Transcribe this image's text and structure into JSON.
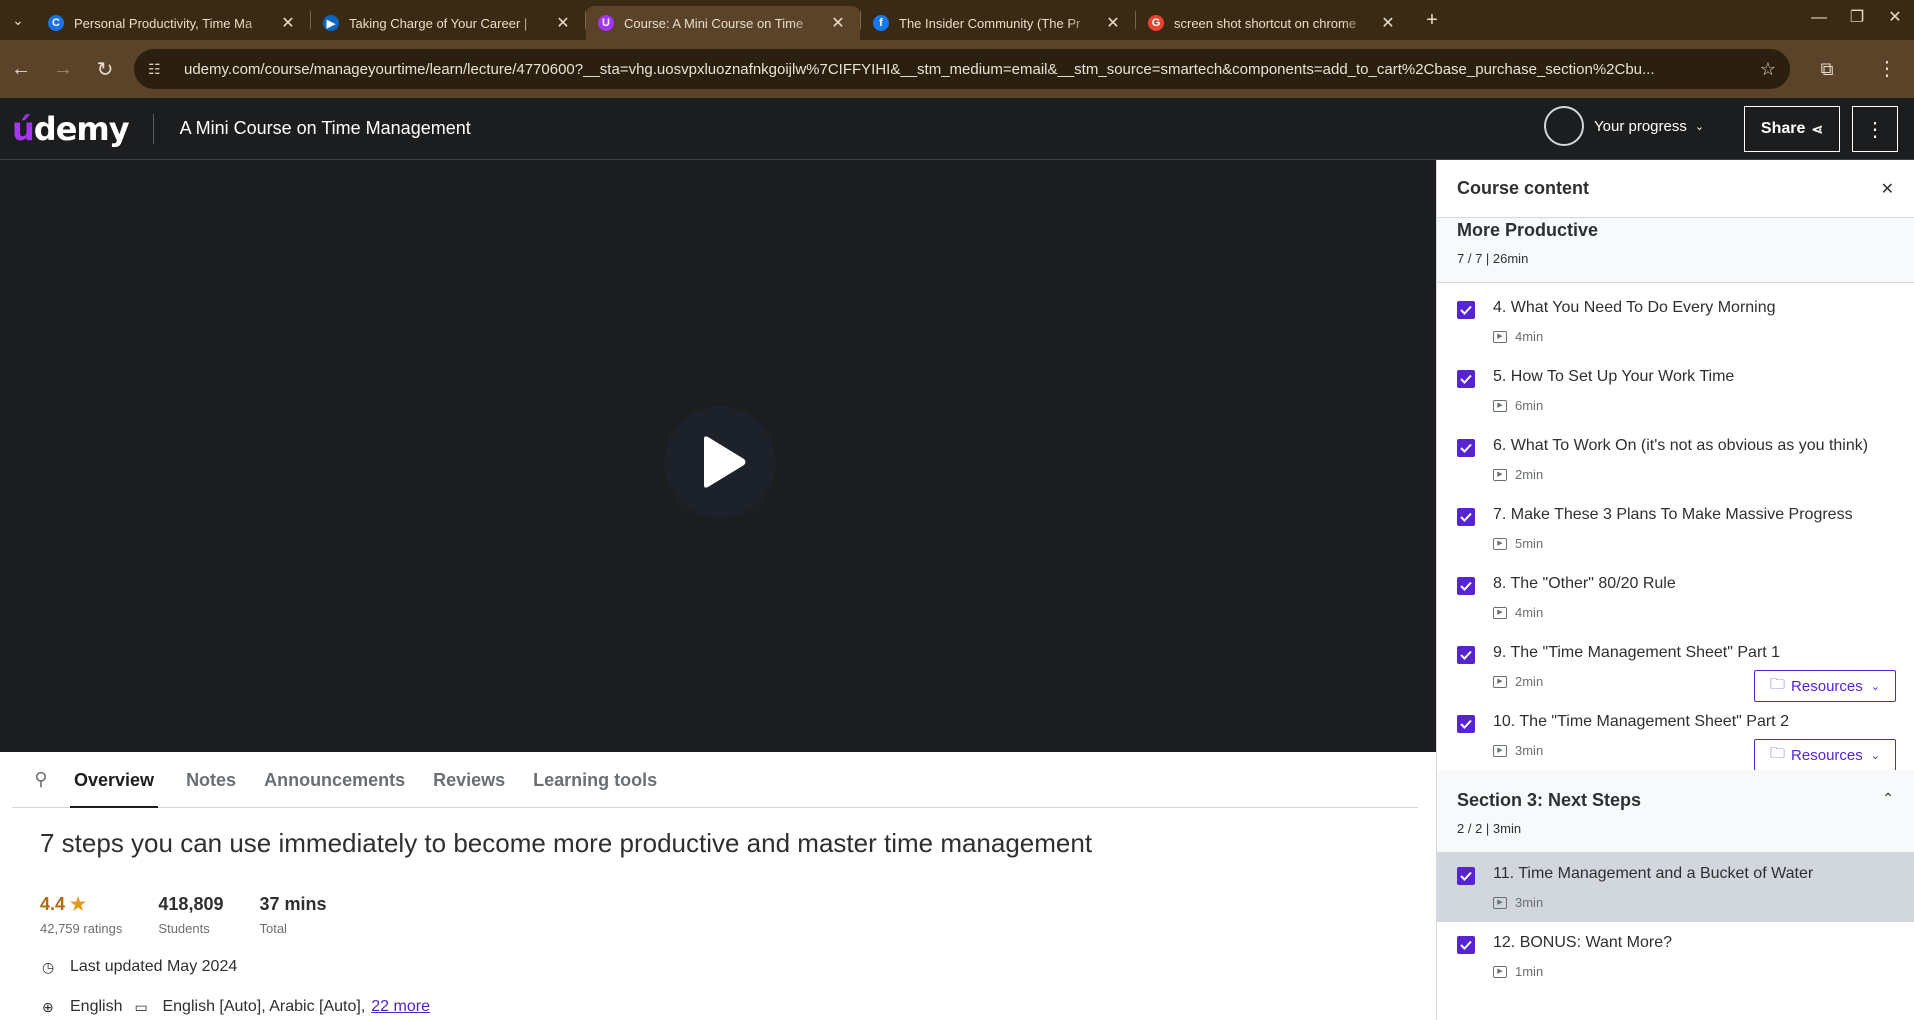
{
  "browser": {
    "tabs": [
      {
        "title": "Personal Productivity, Time Ma",
        "favicon": "C",
        "color": "#1a73e8"
      },
      {
        "title": "Taking Charge of Your Career | ",
        "favicon": "▶",
        "color": "#0a66c2"
      },
      {
        "title": "Course: A Mini Course on Time",
        "favicon": "U",
        "color": "#a435f0"
      },
      {
        "title": "The Insider Community (The Pr",
        "favicon": "f",
        "color": "#1877f2"
      },
      {
        "title": "screen shot shortcut on chrome",
        "favicon": "G",
        "color": "#ea4335"
      }
    ],
    "url": "udemy.com/course/manageyourtime/learn/lecture/4770600?__sta=vhg.uosvpxluoznafnkgoijlw%7CIFFYIHI&__stm_medium=email&__stm_source=smartech&components=add_to_cart%2Cbase_purchase_section%2Cbu..."
  },
  "header": {
    "logo": "udemy",
    "course_title": "A Mini Course on Time Management",
    "progress_label": "Your progress",
    "share_label": "Share"
  },
  "content_tabs": [
    "Overview",
    "Notes",
    "Announcements",
    "Reviews",
    "Learning tools"
  ],
  "overview": {
    "title": "7 steps you can use immediately to become more productive and master time management",
    "rating": "4.4",
    "rating_count": "42,759 ratings",
    "students": "418,809",
    "students_label": "Students",
    "duration": "37 mins",
    "duration_label": "Total",
    "updated": "Last updated May 2024",
    "language": "English",
    "captions": "English [Auto], Arabic [Auto],",
    "captions_more": "22 more"
  },
  "sidebar": {
    "title": "Course content",
    "section2": {
      "title": "More Productive",
      "meta": "7 / 7 | 26min"
    },
    "lectures": [
      {
        "title": "4. What You Need To Do Every Morning",
        "dur": "4min",
        "resources": false
      },
      {
        "title": "5. How To Set Up Your Work Time",
        "dur": "6min",
        "resources": false
      },
      {
        "title": "6. What To Work On (it's not as obvious as you think)",
        "dur": "2min",
        "resources": false
      },
      {
        "title": "7. Make These 3 Plans To Make Massive Progress",
        "dur": "5min",
        "resources": false
      },
      {
        "title": "8. The \"Other\" 80/20 Rule",
        "dur": "4min",
        "resources": false
      },
      {
        "title": "9. The \"Time Management Sheet\" Part 1",
        "dur": "2min",
        "resources": true
      },
      {
        "title": "10. The \"Time Management Sheet\" Part 2",
        "dur": "3min",
        "resources": true
      }
    ],
    "resources_label": "Resources",
    "section3": {
      "title": "Section 3: Next Steps",
      "meta": "2 / 2 | 3min"
    },
    "lectures3": [
      {
        "title": "11. Time Management and a Bucket of Water",
        "dur": "3min"
      },
      {
        "title": "12. BONUS: Want More?",
        "dur": "1min"
      }
    ]
  }
}
